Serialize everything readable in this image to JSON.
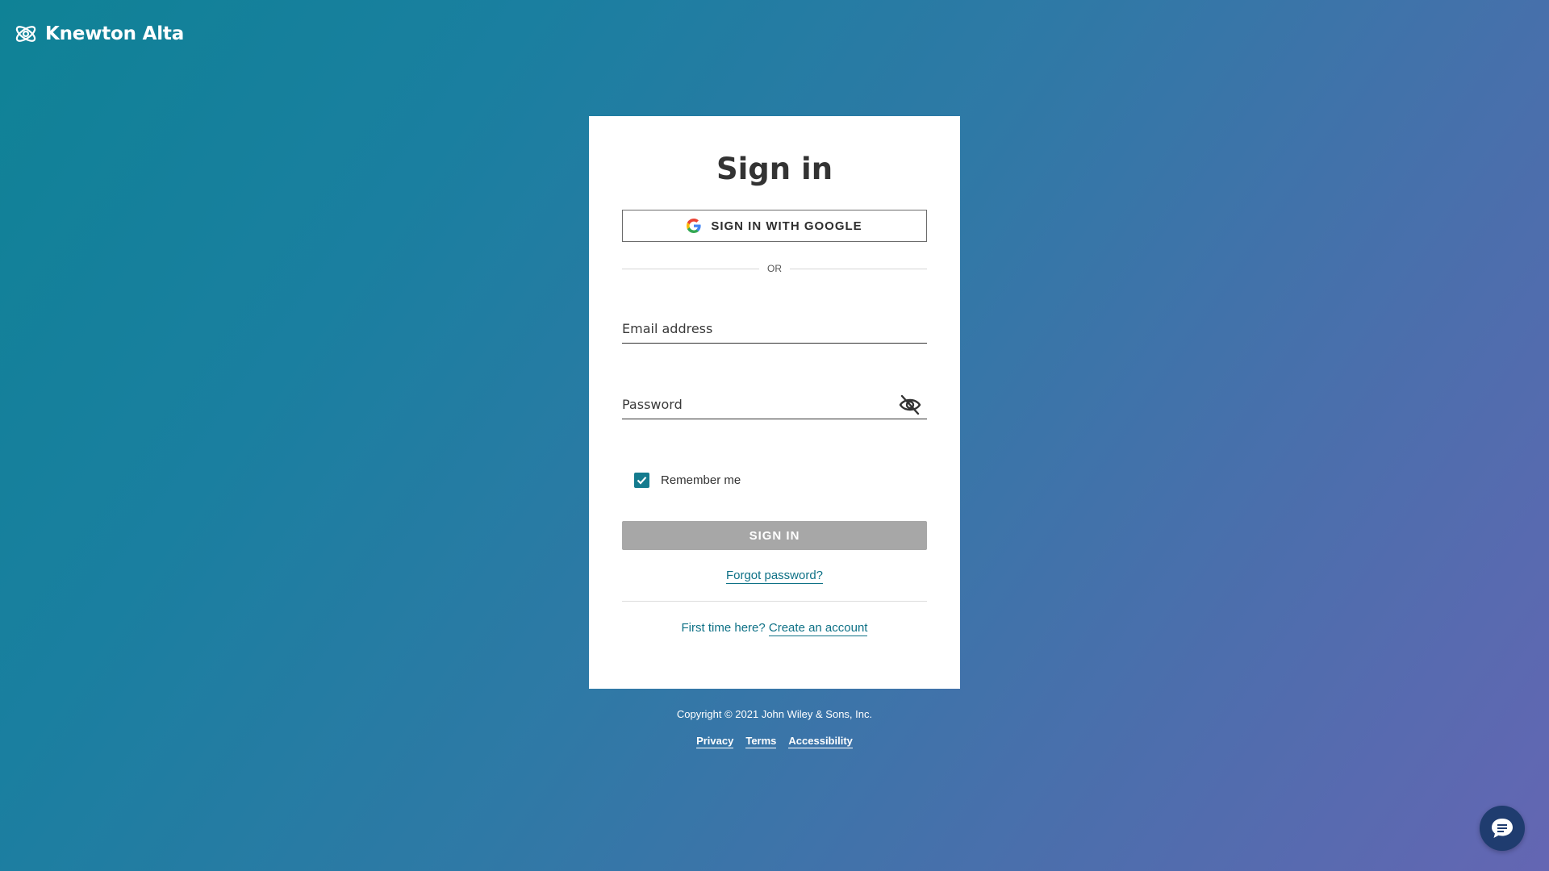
{
  "brand": {
    "name": "Knewton Alta",
    "icon": "atom-logo-icon"
  },
  "card": {
    "title": "Sign in",
    "google_button_label": "SIGN IN WITH GOOGLE",
    "google_icon": "google-g-icon",
    "or_label": "OR",
    "email": {
      "placeholder": "Email address",
      "value": ""
    },
    "password": {
      "placeholder": "Password",
      "value": "",
      "toggle_icon": "eye-slash-icon"
    },
    "remember": {
      "label": "Remember me",
      "checked": true
    },
    "signin_button_label": "SIGN IN",
    "forgot_link": "Forgot password?",
    "first_time_text": "First time here?",
    "create_account_link": "Create an account"
  },
  "footer": {
    "copyright": "Copyright © 2021 John Wiley & Sons, Inc.",
    "links": [
      "Privacy",
      "Terms",
      "Accessibility"
    ]
  },
  "chat": {
    "icon": "chat-bubble-icon"
  },
  "colors": {
    "accent": "#147b8e",
    "link": "#0e7186",
    "disabled_button": "#a7a7a7",
    "chat_button": "#1f3c6f"
  }
}
